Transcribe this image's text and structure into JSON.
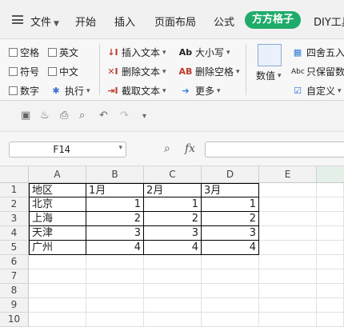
{
  "menu": {
    "file": "文件",
    "tabs": [
      "开始",
      "插入",
      "页面布局",
      "公式"
    ],
    "active_tab": "方方格子",
    "extra_tab": "DIY工具"
  },
  "ribbon": {
    "checkboxes": [
      "空格",
      "英文",
      "符号",
      "中文",
      "数字"
    ],
    "execute": "执行",
    "insert_text": "插入文本",
    "delete_text": "删除文本",
    "extract_text": "截取文本",
    "case": "大小写",
    "delete_spaces": "删除空格",
    "more": "更多",
    "numeric": "数值",
    "round": "四舍五入",
    "keep_valid": "只保留数",
    "custom": "自定义"
  },
  "name_box": "F14",
  "fx_label": "fx",
  "columns": [
    "A",
    "B",
    "C",
    "D",
    "E"
  ],
  "rows": [
    "1",
    "2",
    "3",
    "4",
    "5",
    "6",
    "7",
    "8",
    "9",
    "10"
  ],
  "table": {
    "header": [
      "地区",
      "1月",
      "2月",
      "3月"
    ],
    "body": [
      [
        "北京",
        "1",
        "1",
        "1"
      ],
      [
        "上海",
        "2",
        "2",
        "2"
      ],
      [
        "天津",
        "3",
        "3",
        "3"
      ],
      [
        "广州",
        "4",
        "4",
        "4"
      ]
    ]
  },
  "colors": {
    "accent": "#1fab6a"
  }
}
